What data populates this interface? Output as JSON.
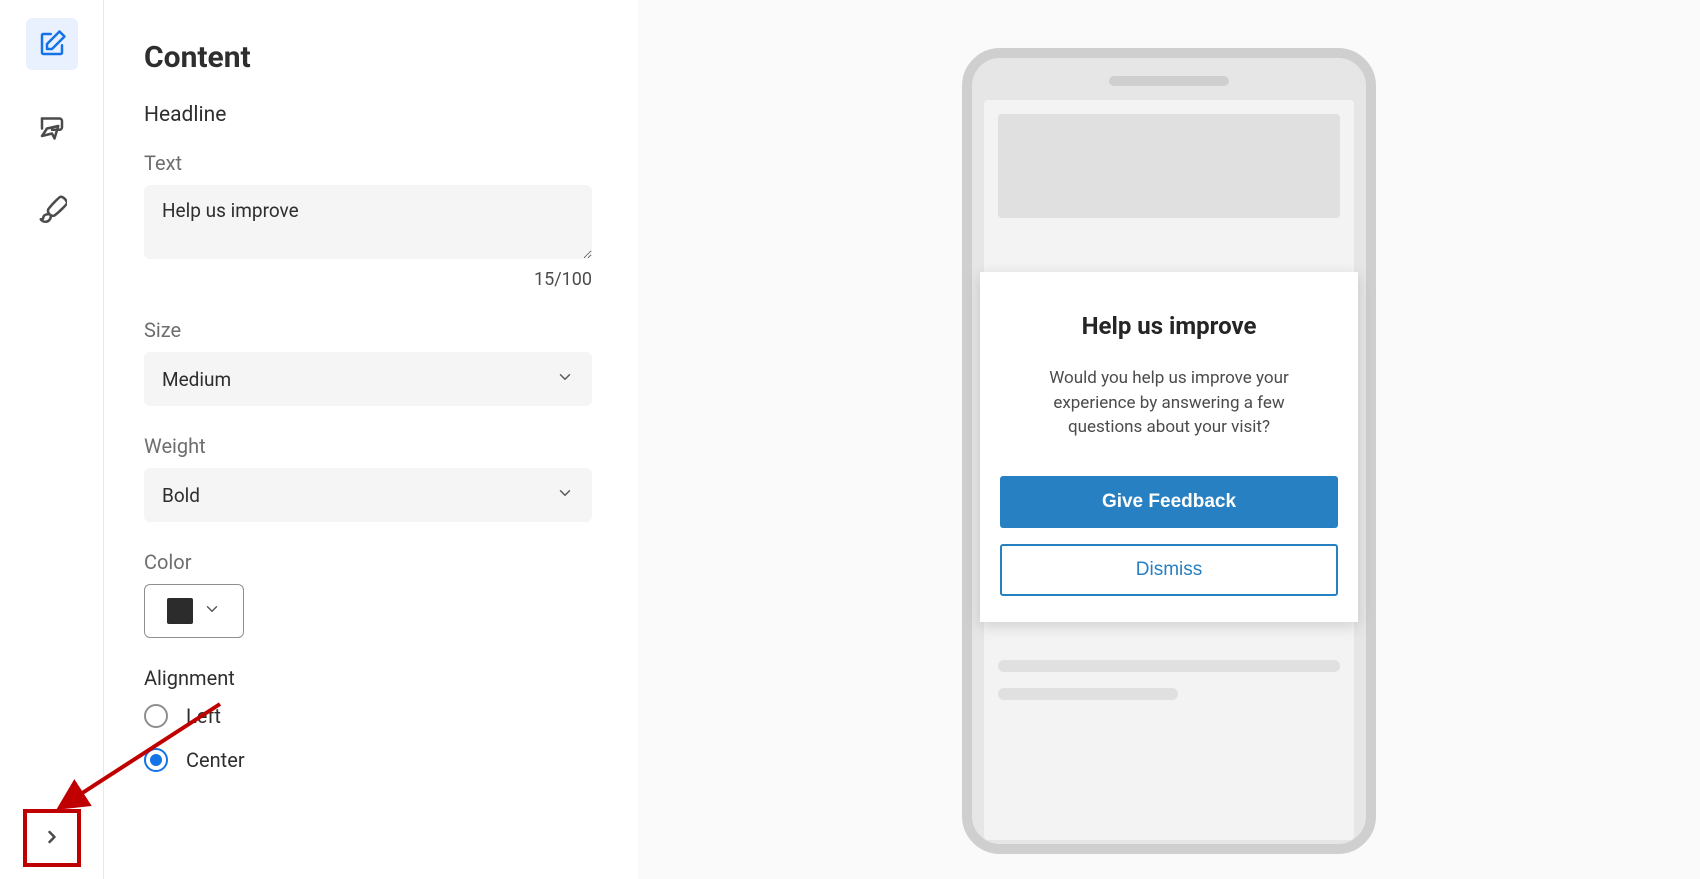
{
  "panel": {
    "title": "Content",
    "section": "Headline",
    "text": {
      "label": "Text",
      "value": "Help us improve",
      "counter": "15/100"
    },
    "size": {
      "label": "Size",
      "value": "Medium"
    },
    "weight": {
      "label": "Weight",
      "value": "Bold"
    },
    "color": {
      "label": "Color",
      "value": "#2c2c2c"
    },
    "alignment": {
      "label": "Alignment",
      "options": {
        "left": "Left",
        "center": "Center"
      },
      "selected": "center"
    }
  },
  "preview": {
    "headline": "Help us improve",
    "body": "Would you help us improve your experience by answering a few questions about your visit?",
    "primary_btn": "Give Feedback",
    "secondary_btn": "Dismiss"
  }
}
